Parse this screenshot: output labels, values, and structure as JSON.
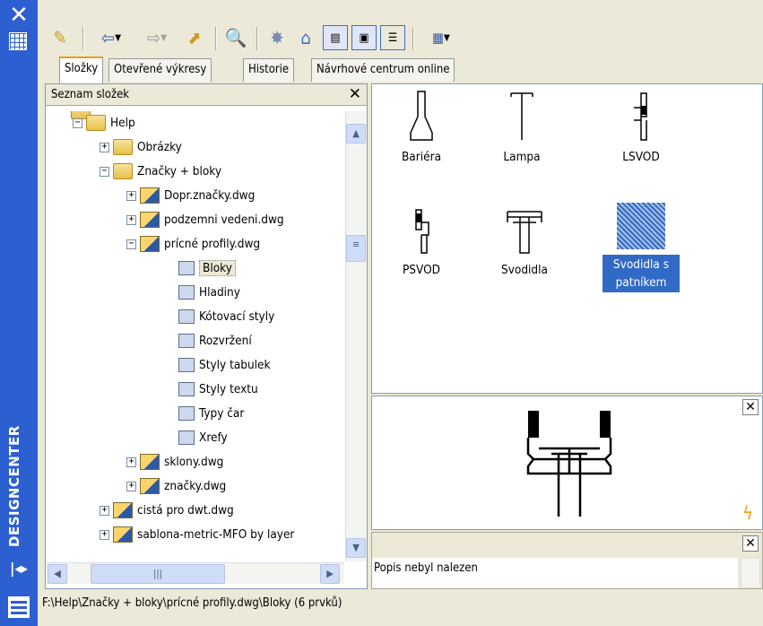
{
  "palette_title": "DESIGNCENTER",
  "tabs": [
    {
      "label": "Složky"
    },
    {
      "label": "Otevřené výkresy"
    },
    {
      "label": "Historie"
    },
    {
      "label": "Návrhové centrum online"
    }
  ],
  "tree": {
    "header": "Seznam složek",
    "nodes": [
      {
        "label": "Help"
      },
      {
        "label": "Obrázky"
      },
      {
        "label": "Značky + bloky"
      },
      {
        "label": "Dopr.značky.dwg"
      },
      {
        "label": "podzemni vedeni.dwg"
      },
      {
        "label": "prícné profily.dwg"
      },
      {
        "label": "Bloky"
      },
      {
        "label": "Hladiny"
      },
      {
        "label": "Kótovací styly"
      },
      {
        "label": "Rozvržení"
      },
      {
        "label": "Styly tabulek"
      },
      {
        "label": "Styly textu"
      },
      {
        "label": "Typy čar"
      },
      {
        "label": "Xrefy"
      },
      {
        "label": "sklony.dwg"
      },
      {
        "label": "značky.dwg"
      },
      {
        "label": "cistá pro dwt.dwg"
      },
      {
        "label": "sablona-metric-MFO by layer"
      }
    ]
  },
  "blocks": [
    {
      "label": "Bariéra"
    },
    {
      "label": "Lampa"
    },
    {
      "label": "LSVOD"
    },
    {
      "label": "PSVOD"
    },
    {
      "label": "Svodidla"
    },
    {
      "label": "Svodidla s patníkem"
    }
  ],
  "description": "Popis nebyl nalezen",
  "status_path": "F:\\Help\\Značky + bloky\\prícné profily.dwg\\Bloky (6 prvků)"
}
